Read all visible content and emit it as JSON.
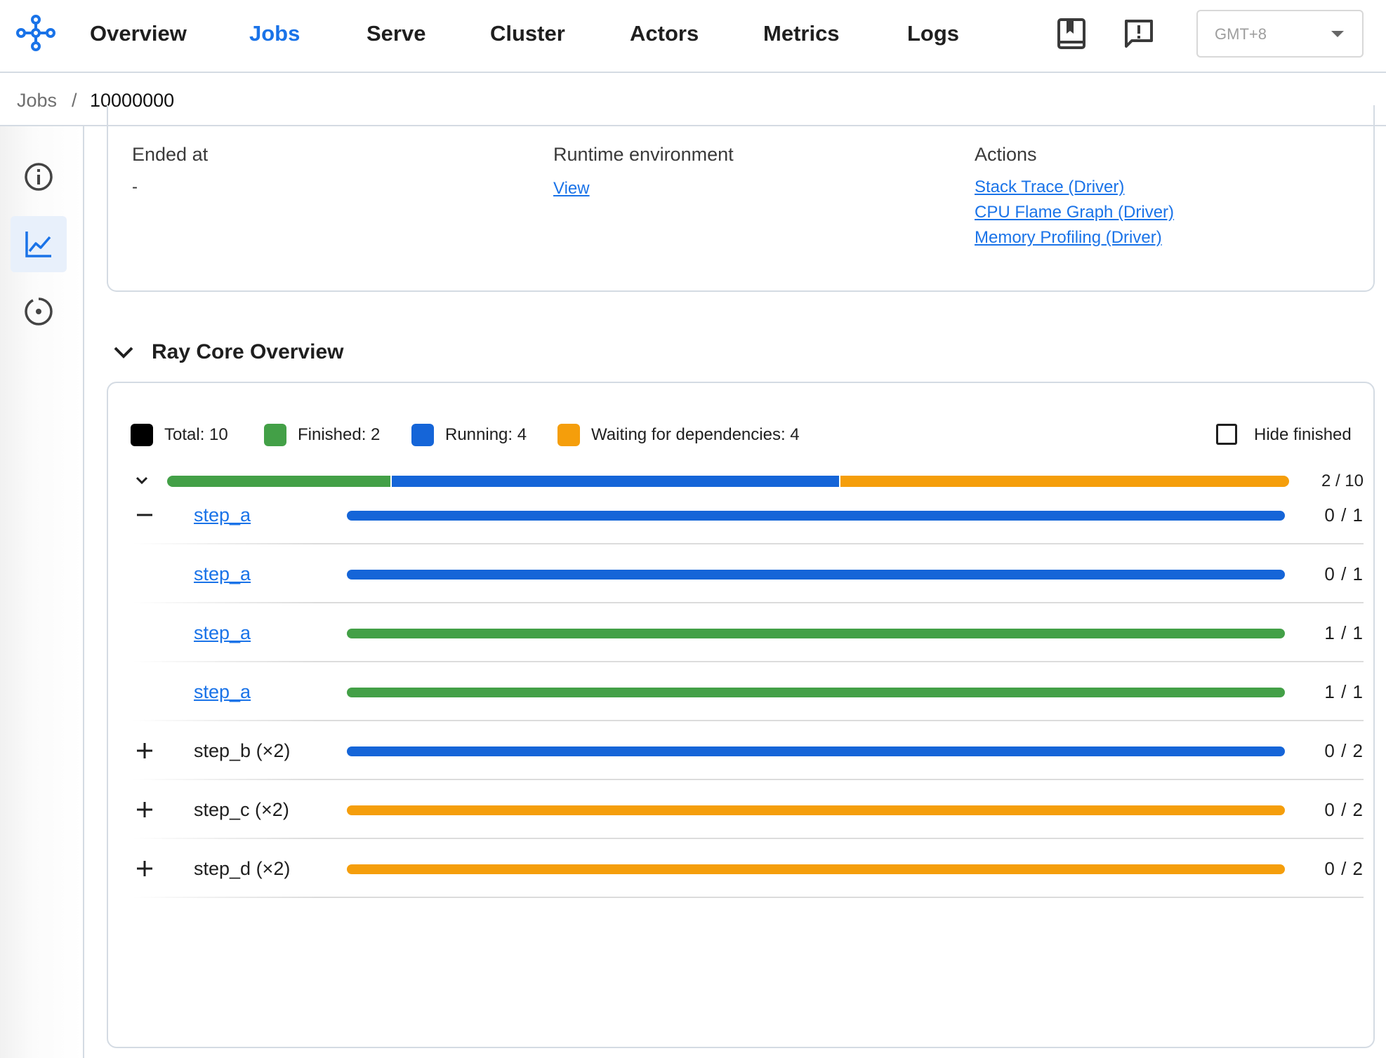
{
  "nav": {
    "items": [
      {
        "label": "Overview",
        "active": false
      },
      {
        "label": "Jobs",
        "active": true
      },
      {
        "label": "Serve",
        "active": false
      },
      {
        "label": "Cluster",
        "active": false
      },
      {
        "label": "Actors",
        "active": false
      },
      {
        "label": "Metrics",
        "active": false
      },
      {
        "label": "Logs",
        "active": false
      }
    ],
    "icons": [
      "docs-book-icon",
      "feedback-icon"
    ],
    "timezone": "GMT+8"
  },
  "breadcrumb": {
    "parent": "Jobs",
    "separator": "/",
    "current": "10000000"
  },
  "sidebar": {
    "icons": [
      "info-icon",
      "chart-line-icon",
      "target-icon"
    ],
    "active_index": 1
  },
  "info": {
    "ended_at_label": "Ended at",
    "ended_at_value": "-",
    "runtime_env_label": "Runtime environment",
    "runtime_env_link": "View",
    "actions_label": "Actions",
    "actions": [
      "Stack Trace (Driver)",
      "CPU Flame Graph (Driver)",
      "Memory Profiling (Driver)"
    ]
  },
  "overview": {
    "title": "Ray Core Overview",
    "legend": [
      {
        "label": "Total: 10",
        "color": "#000000"
      },
      {
        "label": "Finished: 2",
        "color": "#43a047"
      },
      {
        "label": "Running: 4",
        "color": "#1565d8"
      },
      {
        "label": "Waiting for dependencies: 4",
        "color": "#f59e0b"
      }
    ],
    "hide_finished_label": "Hide finished",
    "hide_finished_checked": false,
    "total": {
      "count_label": "2 / 10",
      "finished": 2,
      "running": 4,
      "waiting": 4,
      "total": 10
    },
    "rows": [
      {
        "name": "step_a",
        "is_link": true,
        "expander": "minus",
        "status": "running",
        "count": "0 / 1"
      },
      {
        "name": "step_a",
        "is_link": true,
        "expander": "none",
        "status": "running",
        "count": "0 / 1"
      },
      {
        "name": "step_a",
        "is_link": true,
        "expander": "none",
        "status": "finished",
        "count": "1 / 1"
      },
      {
        "name": "step_a",
        "is_link": true,
        "expander": "none",
        "status": "finished",
        "count": "1 / 1"
      },
      {
        "name": "step_b (×2)",
        "is_link": false,
        "expander": "plus",
        "status": "running",
        "count": "0 / 2"
      },
      {
        "name": "step_c (×2)",
        "is_link": false,
        "expander": "plus",
        "status": "waiting",
        "count": "0 / 2"
      },
      {
        "name": "step_d (×2)",
        "is_link": false,
        "expander": "plus",
        "status": "waiting",
        "count": "0 / 2"
      }
    ]
  }
}
